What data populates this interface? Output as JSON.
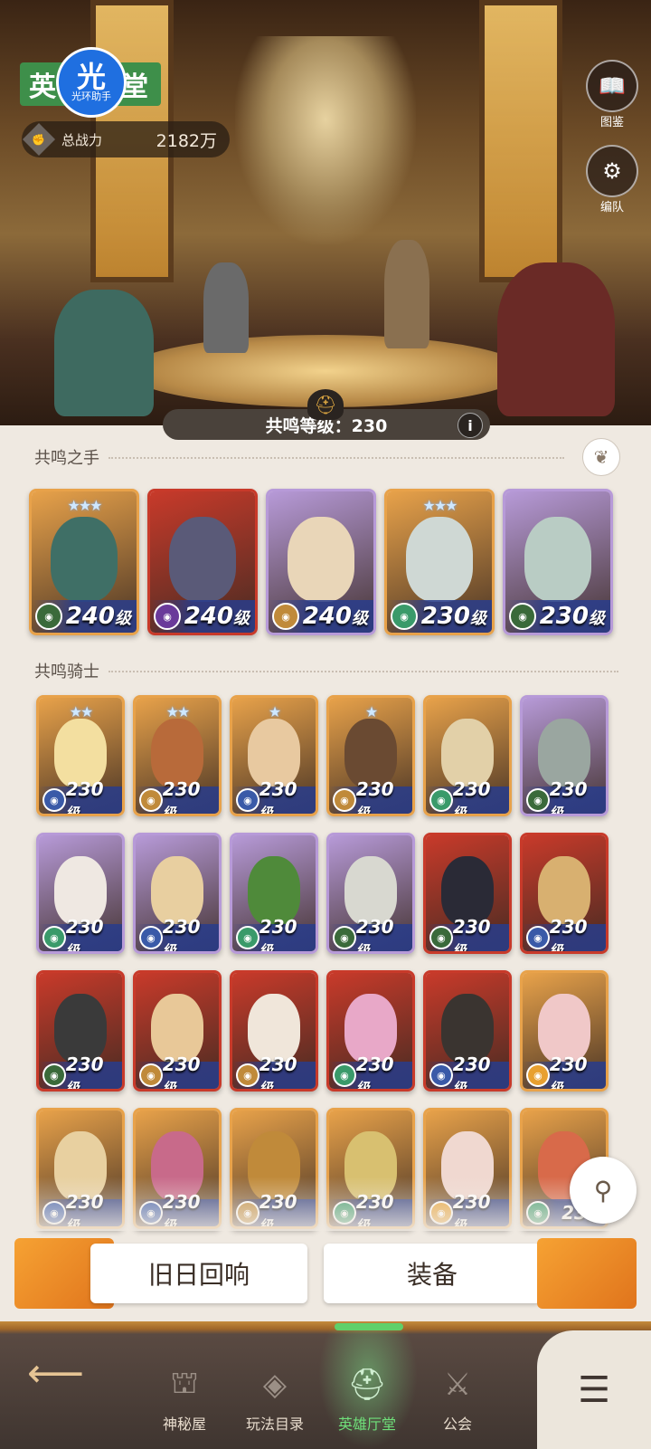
{
  "header": {
    "title": "英雄厅堂",
    "logo_char": "光",
    "logo_sub": "光环助手",
    "power_label": "总战力",
    "power_value": "2182万"
  },
  "side_buttons": [
    {
      "label": "图鉴",
      "icon": "book-icon"
    },
    {
      "label": "编队",
      "icon": "team-icon"
    }
  ],
  "resonance": {
    "label": "共鸣等级：230",
    "info": "i"
  },
  "sections": {
    "hands": "共鸣之手",
    "knights": "共鸣骑士"
  },
  "level_suffix": "级",
  "hands": [
    {
      "level": "240",
      "stars": "★★★",
      "bg": "#e8a24a",
      "skin": "#3f6f66",
      "faction": "#3a6a3a"
    },
    {
      "level": "240",
      "stars": "",
      "bg": "#c83a2a",
      "skin": "#5a5a78",
      "faction": "#6a3a9a"
    },
    {
      "level": "240",
      "stars": "",
      "bg": "#b79ad8",
      "skin": "#e9d6b8",
      "faction": "#c08a3a"
    },
    {
      "level": "230",
      "stars": "★★★",
      "bg": "#e8a24a",
      "skin": "#cfd8d4",
      "faction": "#3a9a6a"
    },
    {
      "level": "230",
      "stars": "",
      "bg": "#b79ad8",
      "skin": "#b9ccc4",
      "faction": "#3a6a3a"
    }
  ],
  "knights": [
    {
      "level": "230",
      "stars": "★★",
      "bg": "#e8a24a",
      "skin": "#f3dfa0",
      "faction": "#3a5aa8"
    },
    {
      "level": "230",
      "stars": "★★",
      "bg": "#e8a24a",
      "skin": "#b86a3a",
      "faction": "#c08a3a"
    },
    {
      "level": "230",
      "stars": "★",
      "bg": "#e8a24a",
      "skin": "#e8c9a0",
      "faction": "#3a5aa8"
    },
    {
      "level": "230",
      "stars": "★",
      "bg": "#e8a24a",
      "skin": "#6a4a32",
      "faction": "#c08a3a"
    },
    {
      "level": "230",
      "stars": "",
      "bg": "#e8a24a",
      "skin": "#e2d0a8",
      "faction": "#3a9a6a"
    },
    {
      "level": "230",
      "stars": "",
      "bg": "#b79ad8",
      "skin": "#9aa6a0",
      "faction": "#3a6a3a"
    },
    {
      "level": "230",
      "stars": "",
      "bg": "#b79ad8",
      "skin": "#efe8e2",
      "faction": "#3a9a6a"
    },
    {
      "level": "230",
      "stars": "",
      "bg": "#b79ad8",
      "skin": "#e8cfa0",
      "faction": "#3a5aa8"
    },
    {
      "level": "230",
      "stars": "",
      "bg": "#b79ad8",
      "skin": "#4f8a3a",
      "faction": "#3a9a6a"
    },
    {
      "level": "230",
      "stars": "",
      "bg": "#b79ad8",
      "skin": "#d8d8d0",
      "faction": "#3a6a3a"
    },
    {
      "level": "230",
      "stars": "",
      "bg": "#c83a2a",
      "skin": "#2a2a36",
      "faction": "#3a6a3a"
    },
    {
      "level": "230",
      "stars": "",
      "bg": "#c83a2a",
      "skin": "#d8b070",
      "faction": "#3a5aa8"
    },
    {
      "level": "230",
      "stars": "",
      "bg": "#c83a2a",
      "skin": "#3a3a3a",
      "faction": "#3a6a3a"
    },
    {
      "level": "230",
      "stars": "",
      "bg": "#c83a2a",
      "skin": "#e8c898",
      "faction": "#c08a3a"
    },
    {
      "level": "230",
      "stars": "",
      "bg": "#c83a2a",
      "skin": "#f0e6da",
      "faction": "#c08a3a"
    },
    {
      "level": "230",
      "stars": "",
      "bg": "#c83a2a",
      "skin": "#e8a8c8",
      "faction": "#3a9a6a"
    },
    {
      "level": "230",
      "stars": "",
      "bg": "#c83a2a",
      "skin": "#3a3430",
      "faction": "#3a5aa8"
    },
    {
      "level": "230",
      "stars": "",
      "bg": "#e8a24a",
      "skin": "#f0c8c8",
      "faction": "#e8a030"
    },
    {
      "level": "230",
      "stars": "",
      "bg": "#e8a24a",
      "skin": "#e8d0a0",
      "faction": "#3a5aa8"
    },
    {
      "level": "230",
      "stars": "",
      "bg": "#e8a24a",
      "skin": "#c86a8a",
      "faction": "#3a5aa8"
    },
    {
      "level": "230",
      "stars": "",
      "bg": "#e8a24a",
      "skin": "#c08a3a",
      "faction": "#c08a3a"
    },
    {
      "level": "230",
      "stars": "",
      "bg": "#e8a24a",
      "skin": "#d8c070",
      "faction": "#3a9a6a"
    },
    {
      "level": "230",
      "stars": "",
      "bg": "#e8a24a",
      "skin": "#f0d8d0",
      "faction": "#e8a030"
    },
    {
      "level": "23",
      "stars": "",
      "bg": "#e8a24a",
      "skin": "#d86a4a",
      "faction": "#3a9a6a"
    }
  ],
  "bottom_buttons": {
    "left": "旧日回响",
    "right": "装备"
  },
  "nav": [
    {
      "label": "神秘屋",
      "icon": "wizard-hat-icon"
    },
    {
      "label": "玩法目录",
      "icon": "diamond-grid-icon"
    },
    {
      "label": "英雄厅堂",
      "icon": "helmet-icon"
    },
    {
      "label": "公会",
      "icon": "crossed-swords-icon"
    }
  ]
}
